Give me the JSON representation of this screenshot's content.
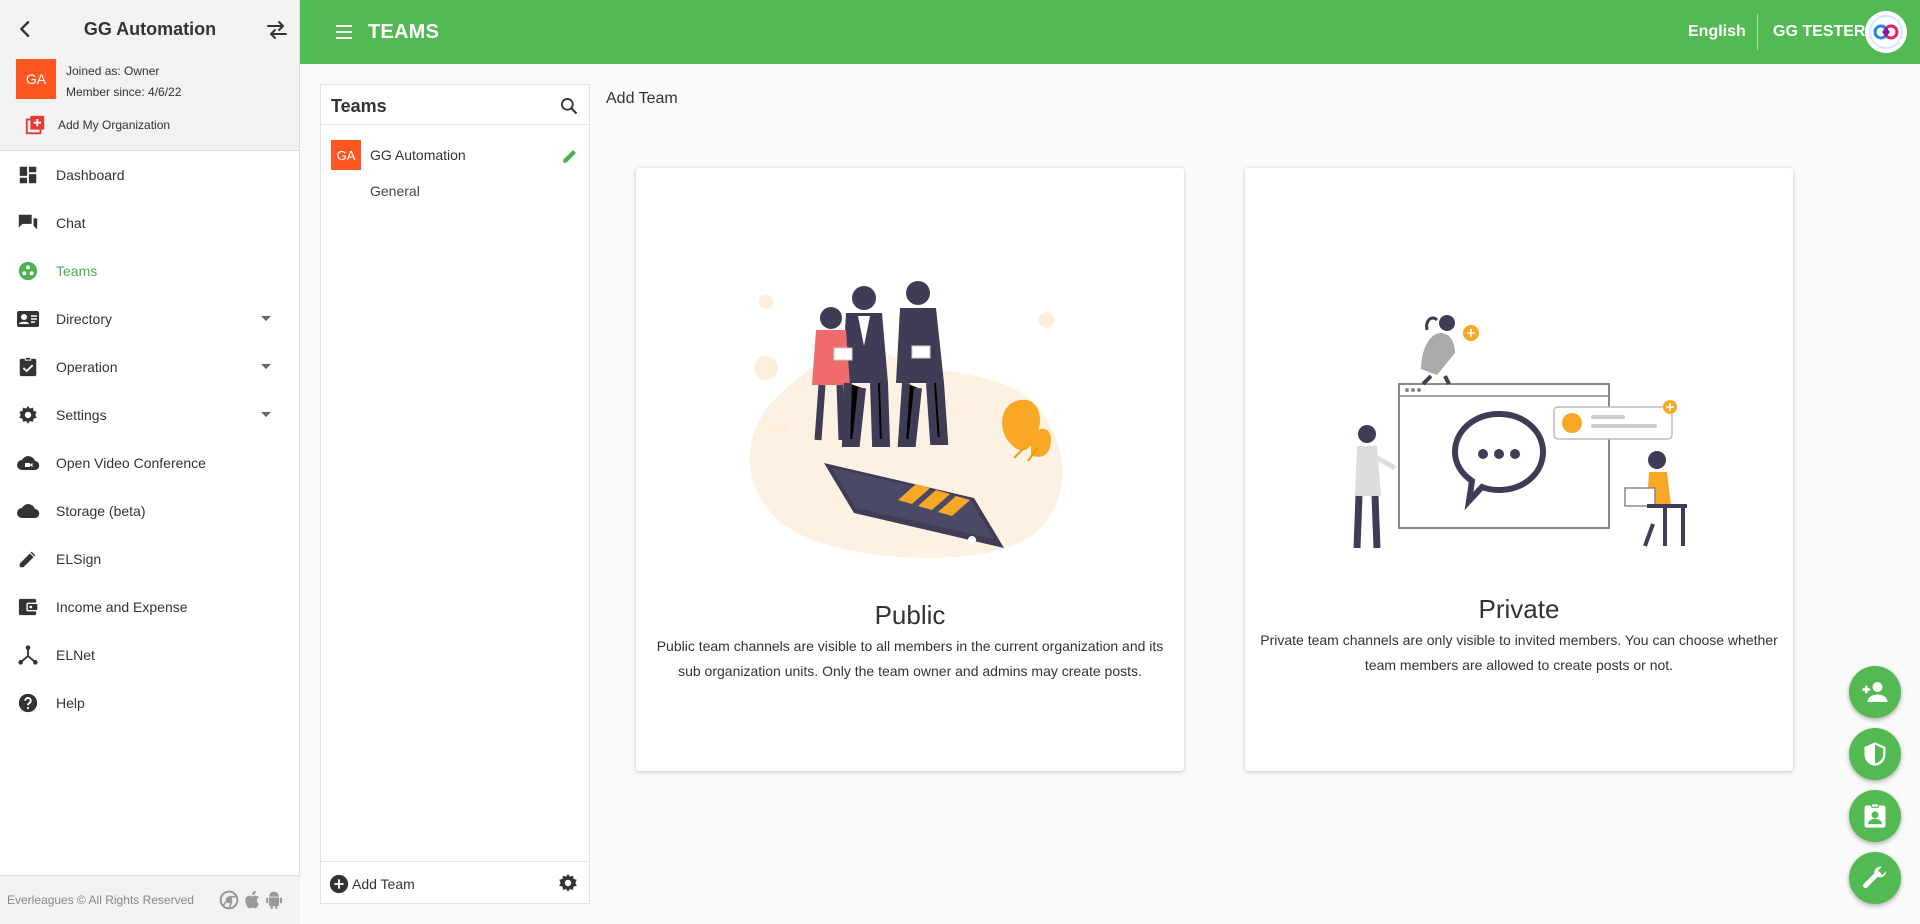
{
  "sidebar": {
    "org_title": "GG Automation",
    "org_initials": "GA",
    "joined": "Joined as: Owner",
    "member_since": "Member since: 4/6/22",
    "add_org": "Add My Organization",
    "items": [
      {
        "label": "Dashboard",
        "icon": "dashboard-icon"
      },
      {
        "label": "Chat",
        "icon": "chat-icon"
      },
      {
        "label": "Teams",
        "icon": "teams-icon",
        "active": true
      },
      {
        "label": "Directory",
        "icon": "contacts-icon",
        "expandable": true
      },
      {
        "label": "Operation",
        "icon": "assignment-icon",
        "expandable": true
      },
      {
        "label": "Settings",
        "icon": "gear-icon",
        "expandable": true
      },
      {
        "label": "Open Video Conference",
        "icon": "cloud-video-icon"
      },
      {
        "label": "Storage (beta)",
        "icon": "cloud-icon"
      },
      {
        "label": "ELSign",
        "icon": "pen-icon"
      },
      {
        "label": "Income and Expense",
        "icon": "wallet-icon"
      },
      {
        "label": "ELNet",
        "icon": "network-icon"
      },
      {
        "label": "Help",
        "icon": "help-icon"
      }
    ],
    "footer": "Everleagues © All Rights Reserved"
  },
  "topbar": {
    "title": "TEAMS",
    "language": "English",
    "user": "GG TESTER"
  },
  "teams_panel": {
    "title": "Teams",
    "team_initials": "GA",
    "team_name": "GG Automation",
    "channel": "General",
    "add_team": "Add Team"
  },
  "main": {
    "header": "Add Team",
    "public": {
      "title": "Public",
      "description": "Public team channels are visible to all members in the current organization and its sub organization units. Only the team owner and admins may create posts."
    },
    "private": {
      "title": "Private",
      "description": "Private team channels are only visible to invited members. You can choose whether team members are allowed to create posts or not."
    }
  },
  "colors": {
    "brand_green": "#53b953",
    "org_orange": "#ff5722",
    "accent_yellow": "#f9a825",
    "dark": "#3f3d56"
  }
}
